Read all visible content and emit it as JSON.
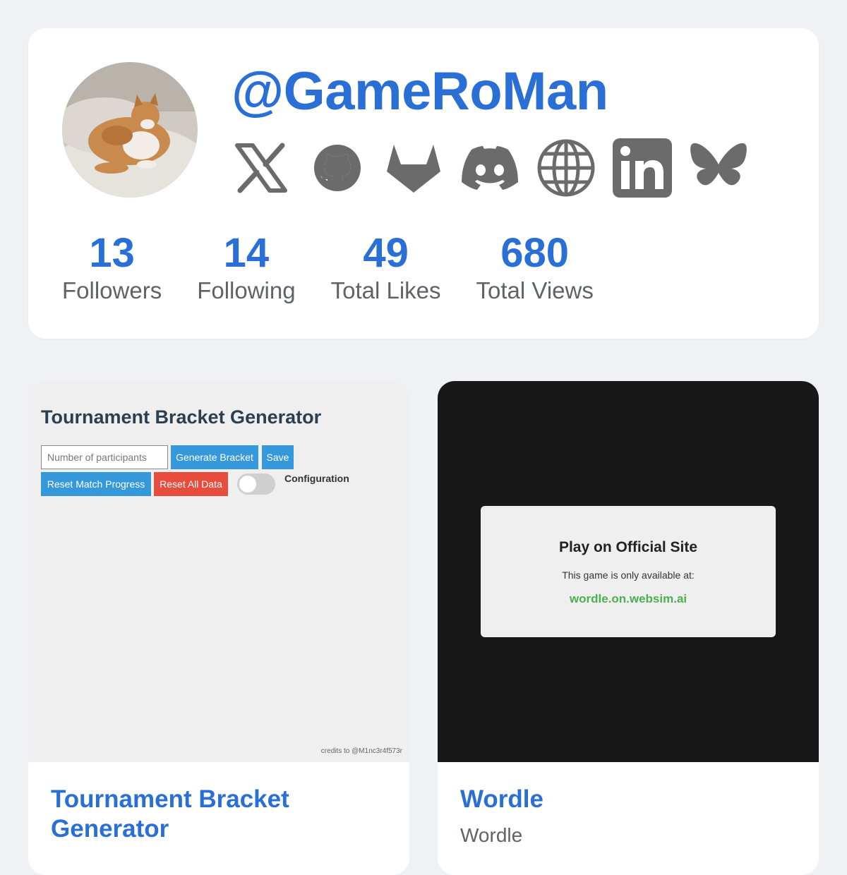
{
  "profile": {
    "username": "@GameRoMan",
    "avatar_icon": "cat-photo-avatar",
    "socials": [
      {
        "name": "x-icon"
      },
      {
        "name": "github-icon"
      },
      {
        "name": "gitlab-icon"
      },
      {
        "name": "discord-icon"
      },
      {
        "name": "globe-icon"
      },
      {
        "name": "linkedin-icon"
      },
      {
        "name": "bluesky-icon"
      }
    ],
    "stats": [
      {
        "value": "13",
        "label": "Followers"
      },
      {
        "value": "14",
        "label": "Following"
      },
      {
        "value": "49",
        "label": "Total Likes"
      },
      {
        "value": "680",
        "label": "Total Views"
      }
    ]
  },
  "games": [
    {
      "title": "Tournament Bracket Generator",
      "preview": {
        "heading": "Tournament Bracket Generator",
        "input_placeholder": "Number of participants",
        "generate_label": "Generate Bracket",
        "save_label": "Save",
        "reset_match_label": "Reset Match Progress",
        "reset_all_label": "Reset All Data",
        "config_label": "Configuration",
        "credits": "credits to @M1nc3r4f573r"
      }
    },
    {
      "title": "Wordle",
      "subtitle": "Wordle",
      "preview": {
        "heading": "Play on Official Site",
        "text": "This game is only available at:",
        "link": "wordle.on.websim.ai"
      }
    }
  ],
  "colors": {
    "accent": "#2a6fd6",
    "icon_gray": "#6b6b6b",
    "button_blue": "#3498db",
    "button_red": "#e74c3c",
    "link_green": "#4caf50"
  }
}
